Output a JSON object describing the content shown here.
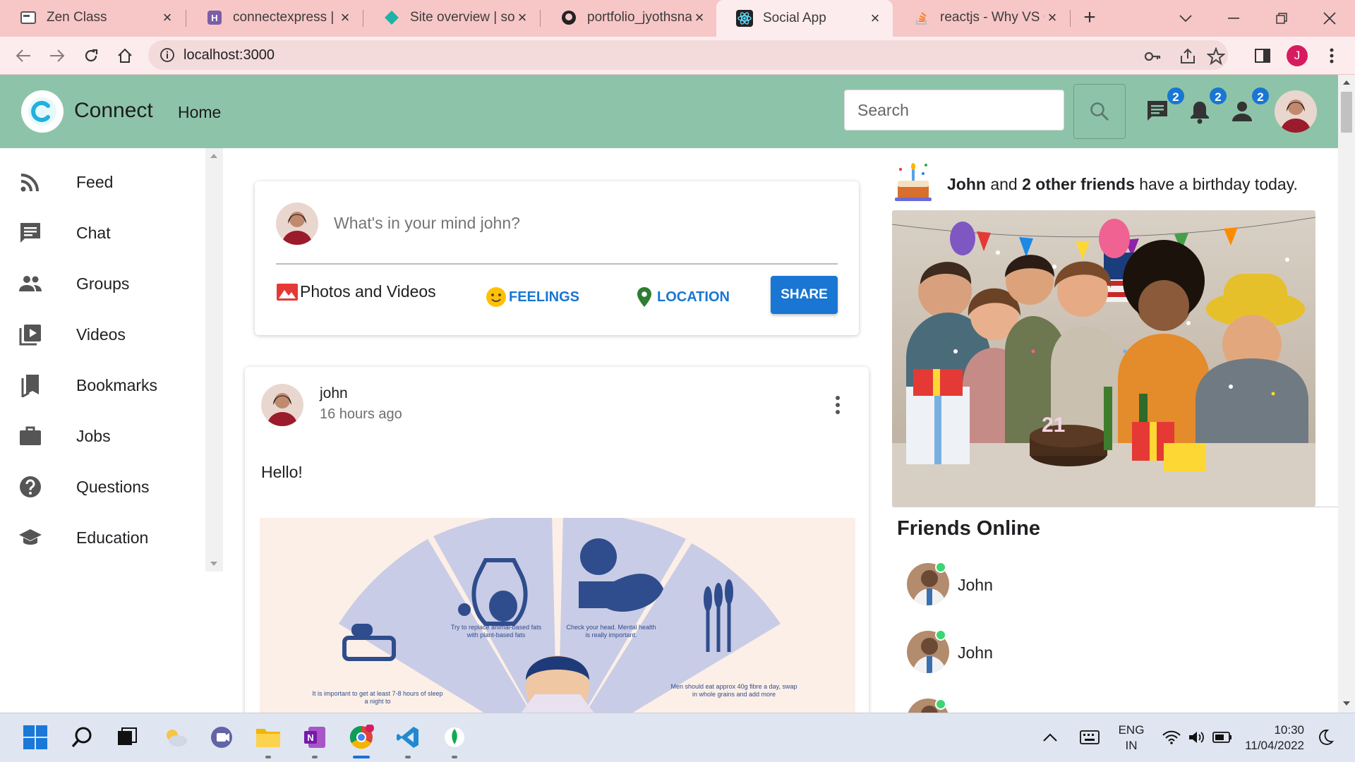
{
  "browser": {
    "tabs": [
      {
        "title": "Zen Class",
        "icon": "zen-class-icon"
      },
      {
        "title": "connectexpress | He",
        "icon": "heroku-icon"
      },
      {
        "title": "Site overview | soci",
        "icon": "netlify-icon"
      },
      {
        "title": "portfolio_jyothsna/",
        "icon": "github-icon"
      },
      {
        "title": "Social App",
        "icon": "react-icon",
        "active": true
      },
      {
        "title": "reactjs - Why VS Co",
        "icon": "stackoverflow-icon"
      }
    ],
    "url": "localhost:3000",
    "profile_initial": "J"
  },
  "app": {
    "brand": "Connect",
    "nav_home": "Home",
    "search_placeholder": "Search",
    "badges": {
      "messages": "2",
      "notifications": "2",
      "friend_requests": "2"
    },
    "header_color": "#8dc4a9"
  },
  "sidebar": {
    "items": [
      {
        "label": "Feed",
        "icon": "rss-feed-icon"
      },
      {
        "label": "Chat",
        "icon": "chat-icon"
      },
      {
        "label": "Groups",
        "icon": "groups-icon"
      },
      {
        "label": "Videos",
        "icon": "video-library-icon"
      },
      {
        "label": "Bookmarks",
        "icon": "bookmarks-icon"
      },
      {
        "label": "Jobs",
        "icon": "work-icon"
      },
      {
        "label": "Questions",
        "icon": "help-icon"
      },
      {
        "label": "Education",
        "icon": "school-icon"
      }
    ]
  },
  "share": {
    "placeholder": "What's in your mind john?",
    "options": {
      "photos": "Photos and Videos",
      "feelings": "FEELINGS",
      "location": "LOCATION"
    },
    "share_button": "SHARE",
    "accent": "#1976d2"
  },
  "post": {
    "author": "john",
    "time": "16 hours ago",
    "text": "Hello!",
    "image_captions": [
      "Try to replace animal-based fats with plant-based fats",
      "Check your head. Mental health is really important.",
      "It is important to get at least 7-8 hours of sleep a night to",
      "Men should eat approx 40g fibre a day, swap in whole grains and add more"
    ]
  },
  "rightbar": {
    "birthday": {
      "name": "John",
      "connector": "and",
      "others": "2 other friends",
      "suffix": "have a birthday today."
    },
    "cake_candle_number": "21",
    "friends_title": "Friends Online",
    "friends": [
      {
        "name": "John"
      },
      {
        "name": "John"
      }
    ]
  },
  "taskbar": {
    "lang_top": "ENG",
    "lang_bottom": "IN",
    "time": "10:30",
    "date": "11/04/2022"
  }
}
